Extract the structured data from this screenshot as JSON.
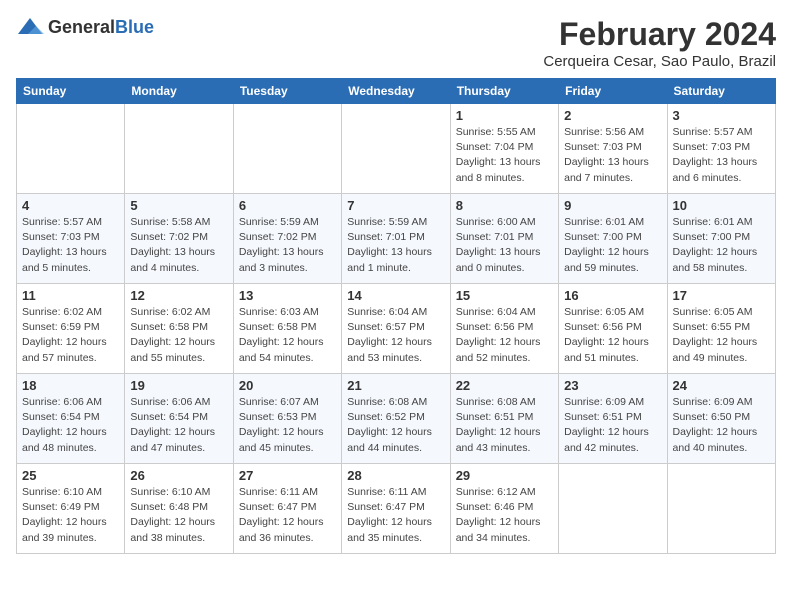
{
  "header": {
    "logo_general": "General",
    "logo_blue": "Blue",
    "title": "February 2024",
    "subtitle": "Cerqueira Cesar, Sao Paulo, Brazil"
  },
  "weekdays": [
    "Sunday",
    "Monday",
    "Tuesday",
    "Wednesday",
    "Thursday",
    "Friday",
    "Saturday"
  ],
  "weeks": [
    [
      {
        "day": "",
        "detail": ""
      },
      {
        "day": "",
        "detail": ""
      },
      {
        "day": "",
        "detail": ""
      },
      {
        "day": "",
        "detail": ""
      },
      {
        "day": "1",
        "detail": "Sunrise: 5:55 AM\nSunset: 7:04 PM\nDaylight: 13 hours and 8 minutes."
      },
      {
        "day": "2",
        "detail": "Sunrise: 5:56 AM\nSunset: 7:03 PM\nDaylight: 13 hours and 7 minutes."
      },
      {
        "day": "3",
        "detail": "Sunrise: 5:57 AM\nSunset: 7:03 PM\nDaylight: 13 hours and 6 minutes."
      }
    ],
    [
      {
        "day": "4",
        "detail": "Sunrise: 5:57 AM\nSunset: 7:03 PM\nDaylight: 13 hours and 5 minutes."
      },
      {
        "day": "5",
        "detail": "Sunrise: 5:58 AM\nSunset: 7:02 PM\nDaylight: 13 hours and 4 minutes."
      },
      {
        "day": "6",
        "detail": "Sunrise: 5:59 AM\nSunset: 7:02 PM\nDaylight: 13 hours and 3 minutes."
      },
      {
        "day": "7",
        "detail": "Sunrise: 5:59 AM\nSunset: 7:01 PM\nDaylight: 13 hours and 1 minute."
      },
      {
        "day": "8",
        "detail": "Sunrise: 6:00 AM\nSunset: 7:01 PM\nDaylight: 13 hours and 0 minutes."
      },
      {
        "day": "9",
        "detail": "Sunrise: 6:01 AM\nSunset: 7:00 PM\nDaylight: 12 hours and 59 minutes."
      },
      {
        "day": "10",
        "detail": "Sunrise: 6:01 AM\nSunset: 7:00 PM\nDaylight: 12 hours and 58 minutes."
      }
    ],
    [
      {
        "day": "11",
        "detail": "Sunrise: 6:02 AM\nSunset: 6:59 PM\nDaylight: 12 hours and 57 minutes."
      },
      {
        "day": "12",
        "detail": "Sunrise: 6:02 AM\nSunset: 6:58 PM\nDaylight: 12 hours and 55 minutes."
      },
      {
        "day": "13",
        "detail": "Sunrise: 6:03 AM\nSunset: 6:58 PM\nDaylight: 12 hours and 54 minutes."
      },
      {
        "day": "14",
        "detail": "Sunrise: 6:04 AM\nSunset: 6:57 PM\nDaylight: 12 hours and 53 minutes."
      },
      {
        "day": "15",
        "detail": "Sunrise: 6:04 AM\nSunset: 6:56 PM\nDaylight: 12 hours and 52 minutes."
      },
      {
        "day": "16",
        "detail": "Sunrise: 6:05 AM\nSunset: 6:56 PM\nDaylight: 12 hours and 51 minutes."
      },
      {
        "day": "17",
        "detail": "Sunrise: 6:05 AM\nSunset: 6:55 PM\nDaylight: 12 hours and 49 minutes."
      }
    ],
    [
      {
        "day": "18",
        "detail": "Sunrise: 6:06 AM\nSunset: 6:54 PM\nDaylight: 12 hours and 48 minutes."
      },
      {
        "day": "19",
        "detail": "Sunrise: 6:06 AM\nSunset: 6:54 PM\nDaylight: 12 hours and 47 minutes."
      },
      {
        "day": "20",
        "detail": "Sunrise: 6:07 AM\nSunset: 6:53 PM\nDaylight: 12 hours and 45 minutes."
      },
      {
        "day": "21",
        "detail": "Sunrise: 6:08 AM\nSunset: 6:52 PM\nDaylight: 12 hours and 44 minutes."
      },
      {
        "day": "22",
        "detail": "Sunrise: 6:08 AM\nSunset: 6:51 PM\nDaylight: 12 hours and 43 minutes."
      },
      {
        "day": "23",
        "detail": "Sunrise: 6:09 AM\nSunset: 6:51 PM\nDaylight: 12 hours and 42 minutes."
      },
      {
        "day": "24",
        "detail": "Sunrise: 6:09 AM\nSunset: 6:50 PM\nDaylight: 12 hours and 40 minutes."
      }
    ],
    [
      {
        "day": "25",
        "detail": "Sunrise: 6:10 AM\nSunset: 6:49 PM\nDaylight: 12 hours and 39 minutes."
      },
      {
        "day": "26",
        "detail": "Sunrise: 6:10 AM\nSunset: 6:48 PM\nDaylight: 12 hours and 38 minutes."
      },
      {
        "day": "27",
        "detail": "Sunrise: 6:11 AM\nSunset: 6:47 PM\nDaylight: 12 hours and 36 minutes."
      },
      {
        "day": "28",
        "detail": "Sunrise: 6:11 AM\nSunset: 6:47 PM\nDaylight: 12 hours and 35 minutes."
      },
      {
        "day": "29",
        "detail": "Sunrise: 6:12 AM\nSunset: 6:46 PM\nDaylight: 12 hours and 34 minutes."
      },
      {
        "day": "",
        "detail": ""
      },
      {
        "day": "",
        "detail": ""
      }
    ]
  ]
}
